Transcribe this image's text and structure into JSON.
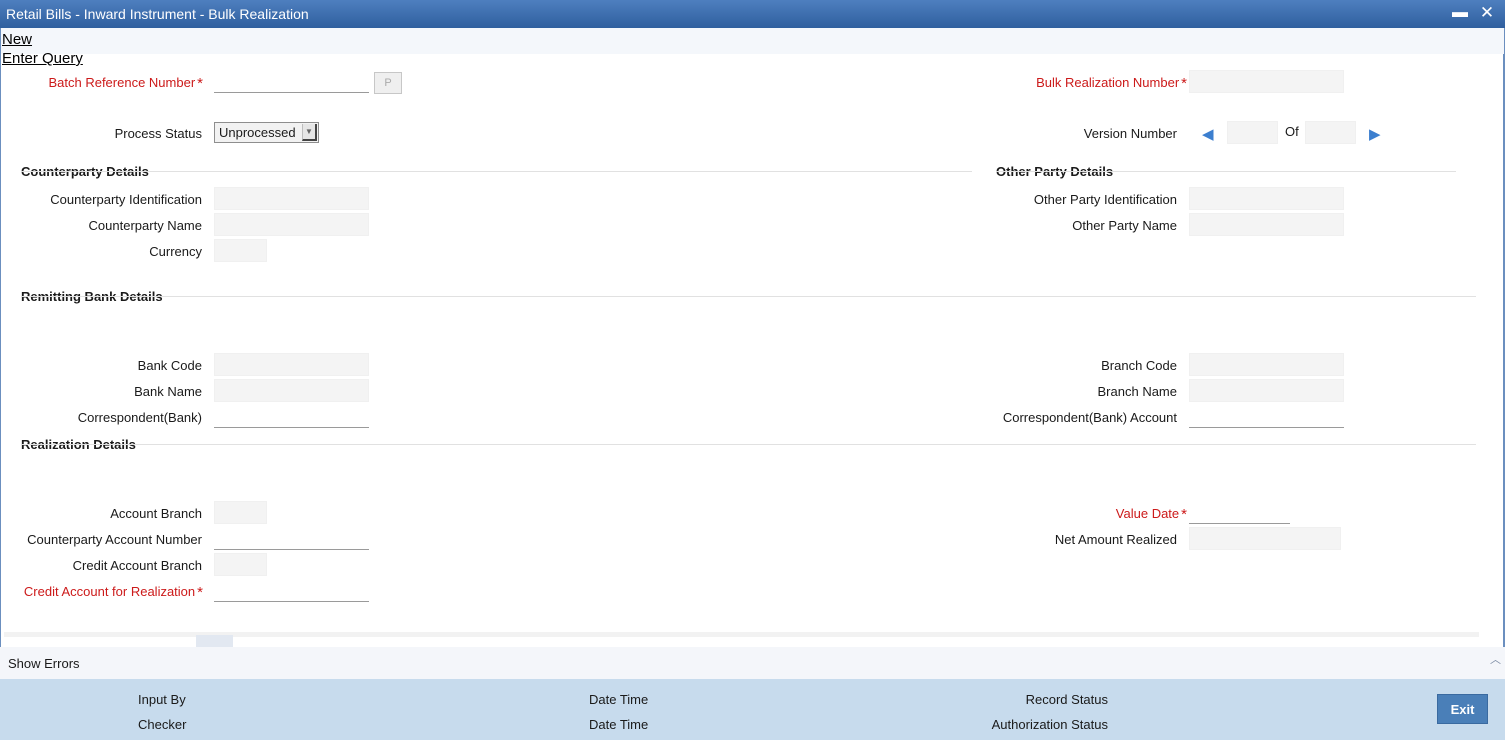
{
  "window": {
    "title": "Retail Bills - Inward Instrument - Bulk Realization",
    "minimize_glyph": "▬",
    "close_glyph": "✕"
  },
  "menu": {
    "new": "New",
    "enter_query": "Enter Query"
  },
  "header": {
    "batch_reference_number": {
      "label": "Batch Reference Number",
      "value": ""
    },
    "p_button": "P",
    "bulk_realization_number": {
      "label": "Bulk Realization Number",
      "value": ""
    },
    "process_status": {
      "label": "Process Status",
      "value": "Unprocessed"
    },
    "version_number": {
      "label": "Version Number",
      "value": "",
      "of_label": "Of",
      "total": ""
    },
    "required_marker": "*"
  },
  "counterparty_details": {
    "title": "Counterparty Details",
    "identification": {
      "label": "Counterparty Identification",
      "value": ""
    },
    "name": {
      "label": "Counterparty Name",
      "value": ""
    },
    "currency": {
      "label": "Currency",
      "value": ""
    }
  },
  "other_party_details": {
    "title": "Other Party Details",
    "identification": {
      "label": "Other Party Identification",
      "value": ""
    },
    "name": {
      "label": "Other Party Name",
      "value": ""
    }
  },
  "remitting_bank_details": {
    "title": "Remitting Bank Details",
    "bank_code": {
      "label": "Bank Code",
      "value": ""
    },
    "bank_name": {
      "label": "Bank Name",
      "value": ""
    },
    "correspondent_bank": {
      "label": "Correspondent(Bank)",
      "value": ""
    },
    "branch_code": {
      "label": "Branch Code",
      "value": ""
    },
    "branch_name": {
      "label": "Branch Name",
      "value": ""
    },
    "correspondent_bank_account": {
      "label": "Correspondent(Bank) Account",
      "value": ""
    }
  },
  "realization_details": {
    "title": "Realization Details",
    "account_branch": {
      "label": "Account Branch",
      "value": ""
    },
    "counterparty_account_number": {
      "label": "Counterparty Account Number",
      "value": ""
    },
    "credit_account_branch": {
      "label": "Credit Account Branch",
      "value": ""
    },
    "credit_account_for_realization": {
      "label": "Credit Account for Realization",
      "value": ""
    },
    "value_date": {
      "label": "Value Date",
      "value": ""
    },
    "net_amount_realized": {
      "label": "Net Amount Realized",
      "value": ""
    }
  },
  "errors_bar": {
    "show_errors": "Show Errors"
  },
  "footer": {
    "input_by": "Input By",
    "checker": "Checker",
    "date_time_1": "Date Time",
    "date_time_2": "Date Time",
    "record_status": "Record Status",
    "authorization_status": "Authorization Status",
    "exit": "Exit"
  },
  "colors": {
    "titlebar": "#3a6aab",
    "required_label": "#cc1a1a",
    "footer_bg": "#c7dbed",
    "exit_button": "#4a7fb8",
    "nav_arrow": "#3c7fcf"
  },
  "icons": {
    "prev_version": "triangle-left-icon",
    "next_version": "triangle-right-icon",
    "dropdown": "chevron-down-icon",
    "collapse": "chevron-up-icon"
  }
}
